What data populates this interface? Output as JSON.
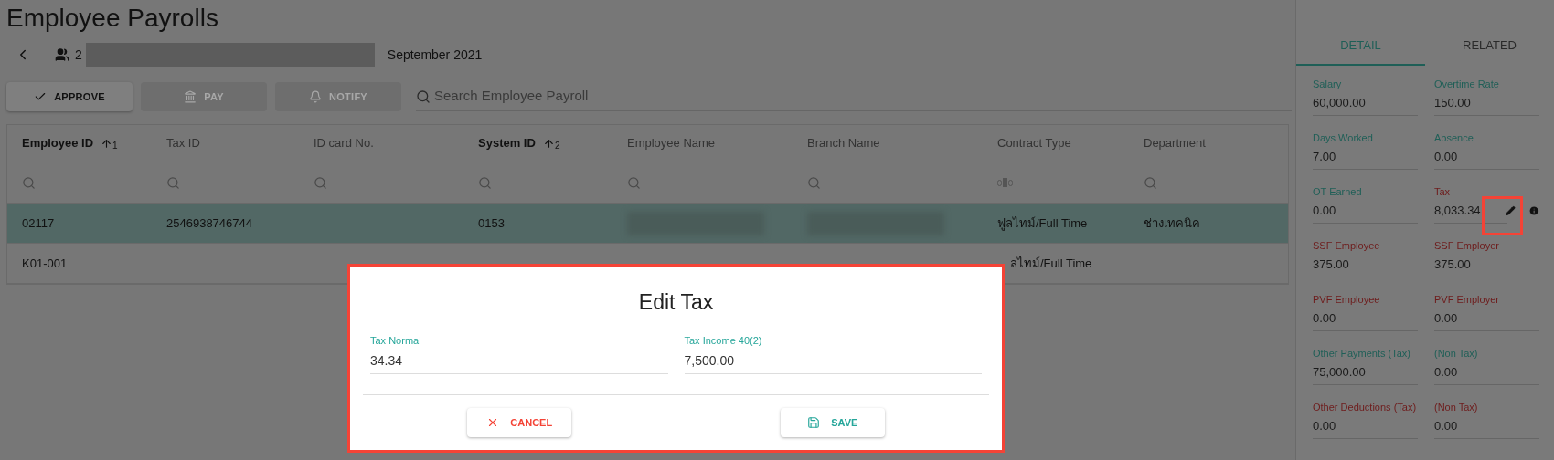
{
  "page": {
    "title": "Employee Payrolls",
    "employee_count": "2",
    "period": "September 2021"
  },
  "toolbar": {
    "buttons": [
      {
        "label": "APPROVE",
        "disabled": false
      },
      {
        "label": "PAY",
        "disabled": true
      },
      {
        "label": "NOTIFY",
        "disabled": true
      }
    ],
    "search": {
      "placeholder": "Search Employee Payroll"
    }
  },
  "table": {
    "columns": [
      {
        "label": "Employee ID",
        "sort": "1",
        "kind": "search"
      },
      {
        "label": "Tax ID",
        "kind": "search"
      },
      {
        "label": "ID card No.",
        "kind": "search"
      },
      {
        "label": "System ID",
        "sort": "2",
        "kind": "search"
      },
      {
        "label": "Employee Name",
        "kind": "search"
      },
      {
        "label": "Branch Name",
        "kind": "search"
      },
      {
        "label": "Contract Type",
        "kind": "text"
      },
      {
        "label": "Department",
        "kind": "search"
      }
    ],
    "rows": [
      {
        "selected": true,
        "cells": [
          {
            "kind": "text",
            "text": "02117"
          },
          {
            "kind": "text",
            "text": "2546938746744"
          },
          {
            "kind": "empty"
          },
          {
            "kind": "text",
            "text": "0153"
          },
          {
            "kind": "redacted"
          },
          {
            "kind": "redacted"
          },
          {
            "kind": "text",
            "text": "ฟูลไทม์/Full Time"
          },
          {
            "kind": "text",
            "text": "ช่างเทคนิค"
          }
        ]
      },
      {
        "selected": false,
        "cells": [
          {
            "kind": "text",
            "text": "K01-001"
          },
          {
            "kind": "empty"
          },
          {
            "kind": "empty"
          },
          {
            "kind": "empty"
          },
          {
            "kind": "empty"
          },
          {
            "kind": "empty"
          },
          {
            "kind": "partial",
            "text": "ลไทม์/Full Time"
          },
          {
            "kind": "empty"
          }
        ]
      }
    ]
  },
  "detail_panel": {
    "tabs": [
      {
        "label": "DETAIL",
        "selected": true
      },
      {
        "label": "RELATED",
        "selected": false
      }
    ],
    "fields": [
      {
        "label": "Salary",
        "value": "60,000.00",
        "color": "#1f5f57"
      },
      {
        "label": "Overtime Rate",
        "value": "150.00",
        "color": "#1f5f57"
      },
      {
        "label": "Days Worked",
        "value": "7.00",
        "color": "#1f5f57"
      },
      {
        "label": "Absence",
        "value": "0.00",
        "color": "#1f5f57"
      },
      {
        "label": "OT Earned",
        "value": "0.00",
        "color": "#1f5f57"
      },
      {
        "label": "Tax",
        "value": "8,033.34",
        "color": "#6e1c1c",
        "kind": "editable"
      },
      {
        "label": "SSF Employee",
        "value": "375.00",
        "color": "#6e1c1c"
      },
      {
        "label": "SSF Employer",
        "value": "375.00",
        "color": "#6e1c1c"
      },
      {
        "label": "PVF Employee",
        "value": "0.00",
        "color": "#6e1c1c"
      },
      {
        "label": "PVF Employer",
        "value": "0.00",
        "color": "#6e1c1c"
      },
      {
        "label": "Other Payments (Tax)",
        "value": "75,000.00",
        "color": "#1f5f57"
      },
      {
        "label": "(Non Tax)",
        "value": "0.00",
        "color": "#1f5f57"
      },
      {
        "label": "Other Deductions (Tax)",
        "value": "0.00",
        "color": "#6e1c1c"
      },
      {
        "label": "(Non Tax)",
        "value": "0.00",
        "color": "#6e1c1c"
      }
    ]
  },
  "dialog": {
    "title": "Edit Tax",
    "fields": [
      {
        "label": "Tax Normal",
        "value": "34.34"
      },
      {
        "label": "Tax Income 40(2)",
        "value": "7,500.00"
      }
    ],
    "buttons": [
      {
        "label": "CANCEL",
        "kind": "cancel"
      },
      {
        "label": "SAVE",
        "kind": "save"
      }
    ]
  }
}
